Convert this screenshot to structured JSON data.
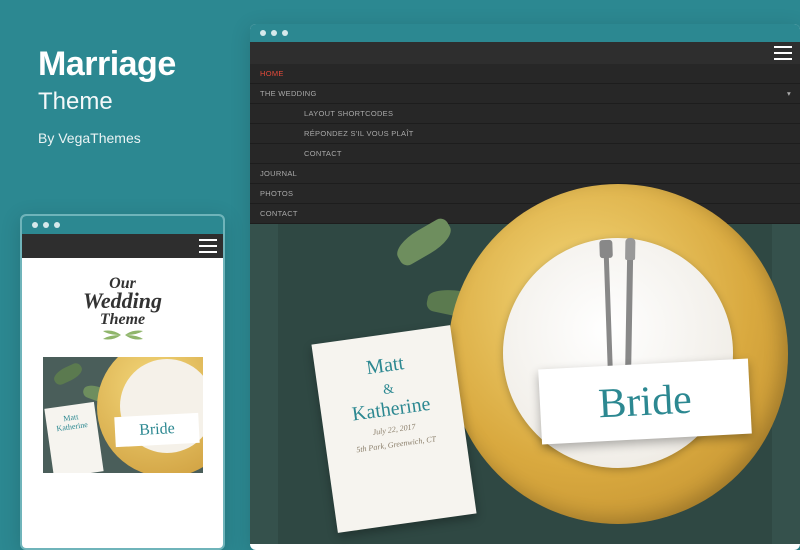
{
  "header": {
    "title": "Marriage",
    "subtitle": "Theme",
    "byline": "By VegaThemes"
  },
  "mobile": {
    "logo": {
      "line1": "Our",
      "line2": "Wedding",
      "line3": "Theme"
    },
    "card_label": "Bride",
    "invite_name1": "Matt",
    "invite_name2": "Katherine"
  },
  "desktop": {
    "menu": {
      "items": [
        {
          "label": "HOME",
          "active": true
        },
        {
          "label": "THE WEDDING",
          "expandable": true
        },
        {
          "label": "LAYOUT SHORTCODES",
          "sub": true
        },
        {
          "label": "RÉPONDEZ S'IL VOUS PLAÎT",
          "sub": true
        },
        {
          "label": "CONTACT",
          "sub": true
        },
        {
          "label": "JOURNAL"
        },
        {
          "label": "PHOTOS"
        },
        {
          "label": "CONTACT"
        }
      ]
    },
    "card_label": "Bride",
    "invite": {
      "name1": "Matt",
      "amp": "&",
      "name2": "Katherine",
      "date": "July 22, 2017",
      "venue": "5th Park, Greenwich, CT"
    }
  }
}
